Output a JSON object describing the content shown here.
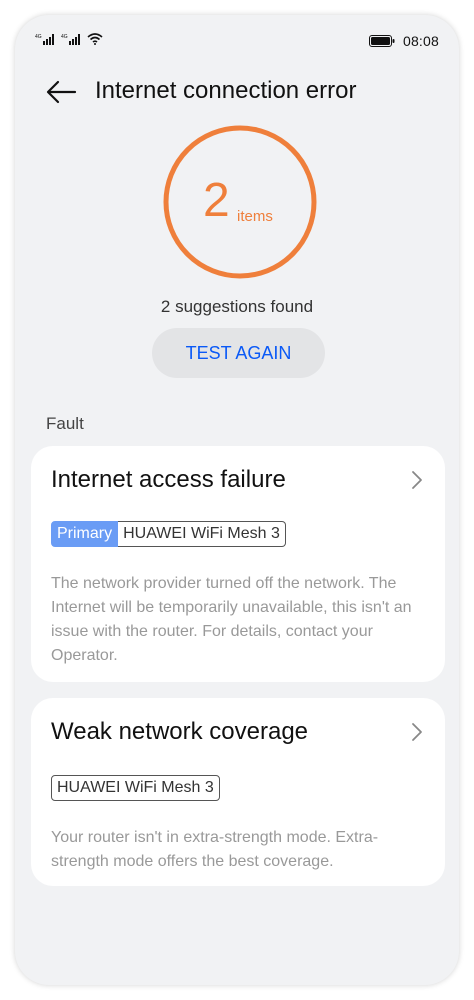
{
  "status_bar": {
    "signal1_label": "4G",
    "signal2_label": "4G",
    "time": "08:08"
  },
  "header": {
    "title": "Internet connection error"
  },
  "summary": {
    "count": "2",
    "unit": "items",
    "text": "2 suggestions found",
    "test_again_label": "TEST AGAIN"
  },
  "section": {
    "label": "Fault"
  },
  "faults": [
    {
      "title": "Internet access failure",
      "primary_tag": "Primary",
      "device_tag": "HUAWEI WiFi Mesh 3",
      "description": "The network provider turned off the network. The Internet will be temporarily unavailable, this isn't an issue with the router. For details, contact your Operator."
    },
    {
      "title": "Weak network coverage",
      "device_tag": "HUAWEI WiFi Mesh 3",
      "description": "Your router isn't in extra-strength mode. Extra-strength mode offers the best coverage."
    }
  ],
  "colors": {
    "accent_orange": "#ef7f3b",
    "link_blue": "#0a59f7",
    "primary_tag_bg": "#6a9cf5",
    "background": "#f1f2f4"
  },
  "icons": [
    "signal-icon",
    "wifi-icon",
    "battery-icon",
    "back-arrow-icon",
    "chevron-right-icon"
  ]
}
